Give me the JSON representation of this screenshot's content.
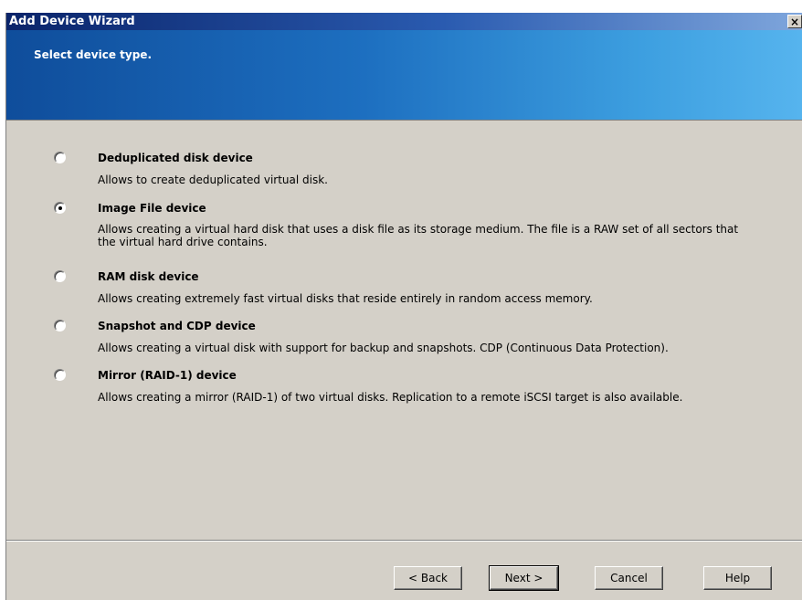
{
  "window": {
    "title": "Add Device Wizard",
    "close_glyph": "×"
  },
  "banner": {
    "title": "Select device type."
  },
  "options": [
    {
      "title": "Deduplicated disk device",
      "description": "Allows to create deduplicated virtual disk.",
      "selected": false
    },
    {
      "title": "Image File device",
      "description": "Allows creating a virtual hard disk that uses a disk file as its storage medium. The file is a RAW set of all sectors that the virtual hard drive contains.",
      "selected": true
    },
    {
      "title": "RAM disk device",
      "description": "Allows creating extremely fast virtual disks that reside entirely in random access memory.",
      "selected": false
    },
    {
      "title": "Snapshot and CDP device",
      "description": "Allows creating a virtual disk with support for backup and snapshots. CDP (Continuous Data Protection).",
      "selected": false
    },
    {
      "title": "Mirror (RAID-1) device",
      "description": "Allows creating a mirror (RAID-1) of two virtual disks. Replication to a remote iSCSI target is also available.",
      "selected": false
    }
  ],
  "buttons": {
    "back": "< Back",
    "next": "Next >",
    "cancel": "Cancel",
    "help": "Help"
  }
}
